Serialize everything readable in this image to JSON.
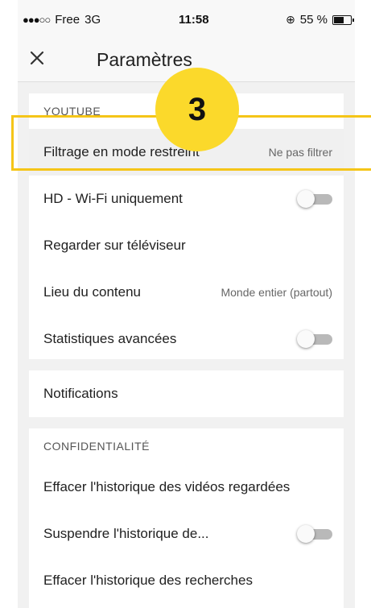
{
  "status_bar": {
    "signal": "●●●○○",
    "carrier": "Free",
    "network": "3G",
    "time": "11:58",
    "rotation_lock_icon": "⊕",
    "battery_percent": "55 %"
  },
  "app_bar": {
    "close_icon": "close-icon",
    "title": "Paramètres"
  },
  "youtube_section": {
    "header": "YOUTUBE",
    "rows": [
      {
        "label": "Filtrage en mode restreint",
        "value": "Ne pas filtrer"
      },
      {
        "label": "HD - Wi-Fi uniquement",
        "toggle": "off"
      },
      {
        "label": "Regarder sur téléviseur"
      },
      {
        "label": "Lieu du contenu",
        "value": "Monde entier (partout)"
      },
      {
        "label": "Statistiques avancées",
        "toggle": "off"
      }
    ]
  },
  "notifications": {
    "label": "Notifications"
  },
  "privacy_section": {
    "header": "CONFIDENTIALITÉ",
    "rows": [
      {
        "label": "Effacer l'historique des vidéos regardées"
      },
      {
        "label": "Suspendre l'historique de...",
        "toggle": "off"
      },
      {
        "label": "Effacer l'historique des recherches"
      }
    ]
  },
  "annotation": {
    "step_number": "3",
    "accent_color": "#f5c518"
  }
}
